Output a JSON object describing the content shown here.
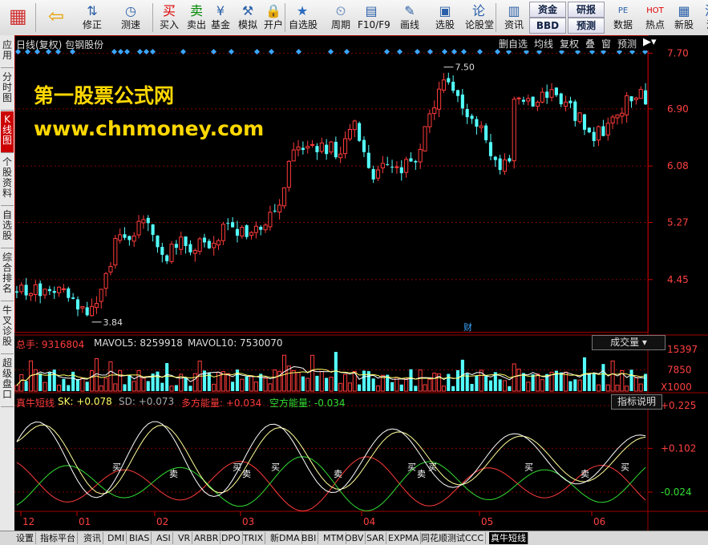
{
  "toolbar": {
    "buttons": [
      {
        "label": "",
        "icon": "grid-icon"
      },
      {
        "label": "",
        "icon": "back-arrow-icon"
      },
      {
        "label": "修正",
        "icon": "up-down-icon"
      },
      {
        "label": "测速",
        "icon": "clock-icon"
      },
      {
        "label": "买入",
        "icon": "buy-icon"
      },
      {
        "label": "卖出",
        "icon": "sell-icon"
      },
      {
        "label": "基金",
        "icon": "fund-icon"
      },
      {
        "label": "模拟",
        "icon": "hammer-icon"
      },
      {
        "label": "开户",
        "icon": "lock-icon"
      },
      {
        "label": "自选股",
        "icon": "star-icon"
      },
      {
        "label": "周期",
        "icon": "period-icon"
      },
      {
        "label": "F10/F9",
        "icon": "f10-icon"
      },
      {
        "label": "画线",
        "icon": "pencil-icon"
      },
      {
        "label": "选股",
        "icon": "screen-icon"
      },
      {
        "label": "论股堂",
        "icon": "forum-icon"
      },
      {
        "label": "资讯",
        "icon": "news-icon"
      },
      {
        "label": "数据",
        "icon": "pe-icon"
      },
      {
        "label": "热点",
        "icon": "hot-icon"
      },
      {
        "label": "新股",
        "icon": "ipo-icon"
      },
      {
        "label": "沪",
        "icon": "sh-icon"
      }
    ],
    "small_buttons": [
      "资金",
      "BBD",
      "研报",
      "预测"
    ]
  },
  "sidebar": {
    "tabs": [
      "应用",
      "分时图",
      "K线图",
      "个股资料",
      "自选股",
      "综合排名",
      "牛叉诊股",
      "超级盘口"
    ]
  },
  "main": {
    "title": "日线(复权) 包钢股份",
    "menu": [
      "删自选",
      "均线",
      "复权",
      "叠",
      "窗",
      "预测"
    ],
    "watermark_line1": "第一股票公式网",
    "watermark_line2": "www.chnmoney.com",
    "price_labels": [
      "7.70",
      "6.90",
      "6.08",
      "5.27",
      "4.45"
    ],
    "high_marker": "7.50",
    "low_marker": "3.84",
    "cai_marker": "财"
  },
  "volume": {
    "label_total": "总手: 9316804",
    "label_ma5": "MAVOL5: 8259918",
    "label_ma10": "MAVOL10: 7530070",
    "selector": "成交量",
    "axis": [
      "15397",
      "7850",
      "X1000"
    ]
  },
  "indicator": {
    "name": "真牛短线",
    "sk": "SK: +0.078",
    "sd": "SD: +0.073",
    "duo": "多方能量: +0.034",
    "kong": "空方能量: -0.034",
    "help": "指标说明",
    "axis": [
      "+0.225",
      "+0.102",
      "-0.024"
    ],
    "buy_label": "买",
    "sell_label": "卖"
  },
  "x_axis": [
    "12",
    "01",
    "02",
    "03",
    "04",
    "05",
    "06"
  ],
  "bottom_tabs": [
    "设置",
    "指标平台",
    "资讯",
    "DMI",
    "BIAS",
    "ASI",
    "VR",
    "ARBR",
    "DPO",
    "TRIX",
    "新DMA",
    "BBI",
    "MTM",
    "OBV",
    "SAR",
    "EXPMA",
    "同花顺测试CCC",
    "真牛短线"
  ],
  "colors": {
    "up": "#ff3b3b",
    "down": "#54ffff",
    "diamond": "#3aa6ff",
    "watermark": "#ffd800",
    "grid": "#800000"
  }
}
